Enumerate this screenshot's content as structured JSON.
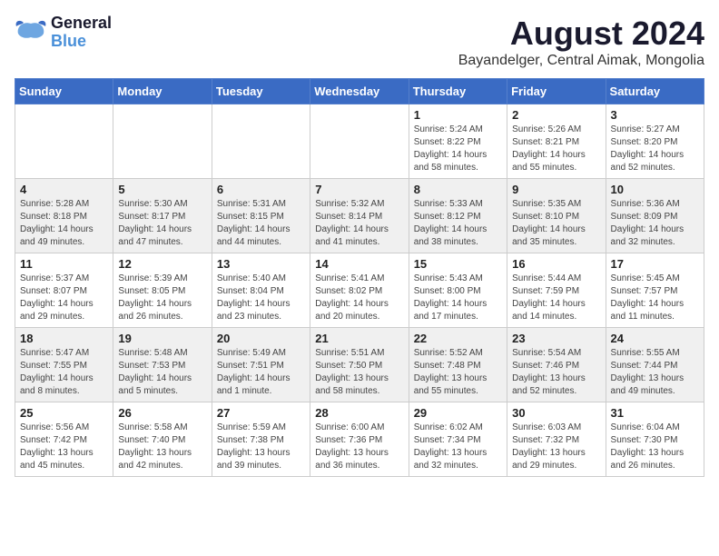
{
  "logo": {
    "line1": "General",
    "line2": "Blue"
  },
  "title": "August 2024",
  "subtitle": "Bayandelger, Central Aimak, Mongolia",
  "headers": [
    "Sunday",
    "Monday",
    "Tuesday",
    "Wednesday",
    "Thursday",
    "Friday",
    "Saturday"
  ],
  "weeks": [
    [
      {
        "day": "",
        "info": ""
      },
      {
        "day": "",
        "info": ""
      },
      {
        "day": "",
        "info": ""
      },
      {
        "day": "",
        "info": ""
      },
      {
        "day": "1",
        "info": "Sunrise: 5:24 AM\nSunset: 8:22 PM\nDaylight: 14 hours\nand 58 minutes."
      },
      {
        "day": "2",
        "info": "Sunrise: 5:26 AM\nSunset: 8:21 PM\nDaylight: 14 hours\nand 55 minutes."
      },
      {
        "day": "3",
        "info": "Sunrise: 5:27 AM\nSunset: 8:20 PM\nDaylight: 14 hours\nand 52 minutes."
      }
    ],
    [
      {
        "day": "4",
        "info": "Sunrise: 5:28 AM\nSunset: 8:18 PM\nDaylight: 14 hours\nand 49 minutes."
      },
      {
        "day": "5",
        "info": "Sunrise: 5:30 AM\nSunset: 8:17 PM\nDaylight: 14 hours\nand 47 minutes."
      },
      {
        "day": "6",
        "info": "Sunrise: 5:31 AM\nSunset: 8:15 PM\nDaylight: 14 hours\nand 44 minutes."
      },
      {
        "day": "7",
        "info": "Sunrise: 5:32 AM\nSunset: 8:14 PM\nDaylight: 14 hours\nand 41 minutes."
      },
      {
        "day": "8",
        "info": "Sunrise: 5:33 AM\nSunset: 8:12 PM\nDaylight: 14 hours\nand 38 minutes."
      },
      {
        "day": "9",
        "info": "Sunrise: 5:35 AM\nSunset: 8:10 PM\nDaylight: 14 hours\nand 35 minutes."
      },
      {
        "day": "10",
        "info": "Sunrise: 5:36 AM\nSunset: 8:09 PM\nDaylight: 14 hours\nand 32 minutes."
      }
    ],
    [
      {
        "day": "11",
        "info": "Sunrise: 5:37 AM\nSunset: 8:07 PM\nDaylight: 14 hours\nand 29 minutes."
      },
      {
        "day": "12",
        "info": "Sunrise: 5:39 AM\nSunset: 8:05 PM\nDaylight: 14 hours\nand 26 minutes."
      },
      {
        "day": "13",
        "info": "Sunrise: 5:40 AM\nSunset: 8:04 PM\nDaylight: 14 hours\nand 23 minutes."
      },
      {
        "day": "14",
        "info": "Sunrise: 5:41 AM\nSunset: 8:02 PM\nDaylight: 14 hours\nand 20 minutes."
      },
      {
        "day": "15",
        "info": "Sunrise: 5:43 AM\nSunset: 8:00 PM\nDaylight: 14 hours\nand 17 minutes."
      },
      {
        "day": "16",
        "info": "Sunrise: 5:44 AM\nSunset: 7:59 PM\nDaylight: 14 hours\nand 14 minutes."
      },
      {
        "day": "17",
        "info": "Sunrise: 5:45 AM\nSunset: 7:57 PM\nDaylight: 14 hours\nand 11 minutes."
      }
    ],
    [
      {
        "day": "18",
        "info": "Sunrise: 5:47 AM\nSunset: 7:55 PM\nDaylight: 14 hours\nand 8 minutes."
      },
      {
        "day": "19",
        "info": "Sunrise: 5:48 AM\nSunset: 7:53 PM\nDaylight: 14 hours\nand 5 minutes."
      },
      {
        "day": "20",
        "info": "Sunrise: 5:49 AM\nSunset: 7:51 PM\nDaylight: 14 hours\nand 1 minute."
      },
      {
        "day": "21",
        "info": "Sunrise: 5:51 AM\nSunset: 7:50 PM\nDaylight: 13 hours\nand 58 minutes."
      },
      {
        "day": "22",
        "info": "Sunrise: 5:52 AM\nSunset: 7:48 PM\nDaylight: 13 hours\nand 55 minutes."
      },
      {
        "day": "23",
        "info": "Sunrise: 5:54 AM\nSunset: 7:46 PM\nDaylight: 13 hours\nand 52 minutes."
      },
      {
        "day": "24",
        "info": "Sunrise: 5:55 AM\nSunset: 7:44 PM\nDaylight: 13 hours\nand 49 minutes."
      }
    ],
    [
      {
        "day": "25",
        "info": "Sunrise: 5:56 AM\nSunset: 7:42 PM\nDaylight: 13 hours\nand 45 minutes."
      },
      {
        "day": "26",
        "info": "Sunrise: 5:58 AM\nSunset: 7:40 PM\nDaylight: 13 hours\nand 42 minutes."
      },
      {
        "day": "27",
        "info": "Sunrise: 5:59 AM\nSunset: 7:38 PM\nDaylight: 13 hours\nand 39 minutes."
      },
      {
        "day": "28",
        "info": "Sunrise: 6:00 AM\nSunset: 7:36 PM\nDaylight: 13 hours\nand 36 minutes."
      },
      {
        "day": "29",
        "info": "Sunrise: 6:02 AM\nSunset: 7:34 PM\nDaylight: 13 hours\nand 32 minutes."
      },
      {
        "day": "30",
        "info": "Sunrise: 6:03 AM\nSunset: 7:32 PM\nDaylight: 13 hours\nand 29 minutes."
      },
      {
        "day": "31",
        "info": "Sunrise: 6:04 AM\nSunset: 7:30 PM\nDaylight: 13 hours\nand 26 minutes."
      }
    ]
  ]
}
